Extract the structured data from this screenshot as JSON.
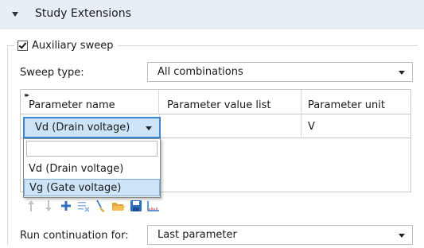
{
  "section": {
    "title": "Study Extensions"
  },
  "auxiliary_sweep": {
    "label": "Auxiliary sweep",
    "checked": true
  },
  "sweep_type": {
    "label": "Sweep type:",
    "value": "All combinations"
  },
  "table": {
    "columns": [
      "Parameter name",
      "Parameter value list",
      "Parameter unit"
    ],
    "rows": [
      {
        "name": "Vd (Drain voltage)",
        "value_list": "",
        "unit": "V"
      }
    ]
  },
  "dropdown": {
    "options": [
      "",
      "Vd (Drain voltage)",
      "Vg (Gate voltage)"
    ],
    "highlighted": "Vg (Gate voltage)"
  },
  "toolbar": {
    "icons": [
      "move-up-icon",
      "move-down-icon",
      "add-icon",
      "delete-icon",
      "range-icon",
      "load-from-file-icon",
      "save-to-file-icon",
      "plot-icon"
    ]
  },
  "run_continuation": {
    "label": "Run continuation for:",
    "value": "Last parameter"
  },
  "colors": {
    "accent": "#3b87d4",
    "selection": "#cde4f6",
    "header_bg": "#e8eef5"
  }
}
